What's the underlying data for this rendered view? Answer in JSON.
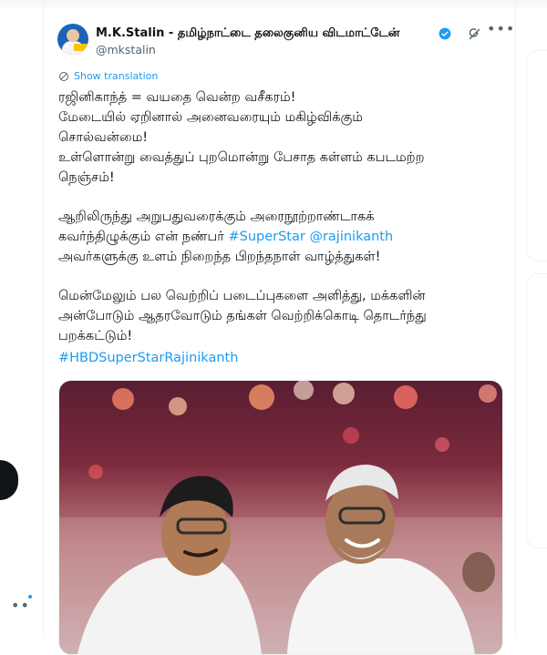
{
  "tweet": {
    "author": {
      "display_name": "M.K.Stalin - தமிழ்நாட்டை தலைகுனிய விடமாட்டேன்",
      "handle": "@mkstalin",
      "verified_icon": "verified-badge-icon",
      "grok_icon": "grok-icon",
      "more_icon": "more-horizontal-icon"
    },
    "show_translation": "Show translation",
    "body_lines": [
      "ரஜினிகாந்த் = வயதை வென்ற வசீகரம்!",
      "மேடையில் ஏறினால் அனைவரையும் மகிழ்விக்கும்",
      "சொல்வன்மை!",
      "உள்ளொன்று வைத்துப் புறமொன்று பேசாத கள்ளம் கபடமற்ற",
      "நெஞ்சம்!",
      "ஆறிலிருந்து அறுபதுவரைக்கும் அரைநூற்றாண்டாகக்",
      "கவர்ந்திழுக்கும் என் நண்பர்",
      "அவர்களுக்கு உளம் நிறைந்த பிறந்தநாள் வாழ்த்துகள்!",
      "மென்மேலும் பல வெற்றிப் படைப்புகளை அளித்து, மக்களின்",
      "அன்போடும் ஆதரவோடும் தங்கள் வெற்றிக்கொடி தொடர்ந்து",
      "பறக்கட்டும்!"
    ],
    "links": {
      "superstar": "#SuperStar",
      "mention": "@rajinikanth",
      "hashtag": "#HBDSuperStarRajinikanth"
    }
  },
  "colors": {
    "link_blue": "#1d9bf0",
    "text": "#0f1419",
    "secondary": "#536471"
  }
}
